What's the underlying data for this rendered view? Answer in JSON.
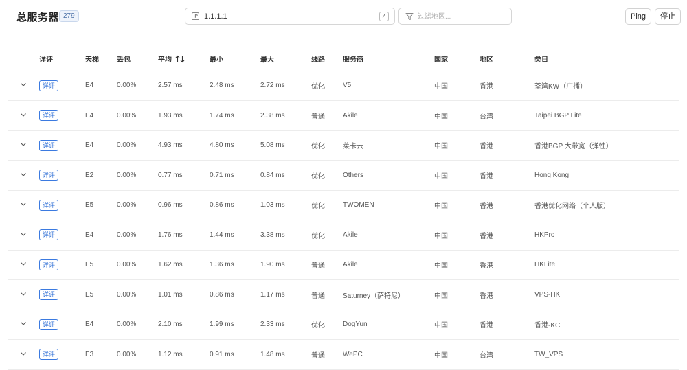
{
  "header": {
    "title": "总服务器",
    "count": "279"
  },
  "search": {
    "value": "1.1.1.1",
    "shortcut": "/",
    "ip_icon": "ip-icon"
  },
  "filter": {
    "placeholder": "过滤地区...",
    "icon": "funnel-icon"
  },
  "buttons": {
    "ping": "Ping",
    "stop": "停止"
  },
  "table": {
    "columns": {
      "detail": "详评",
      "tier": "天梯",
      "loss": "丢包",
      "avg": "平均",
      "min": "最小",
      "max": "最大",
      "route": "线路",
      "provider": "服务商",
      "country": "国家",
      "region": "地区",
      "category": "类目"
    },
    "sort_icon": "sort-arrows-icon",
    "expand_icon": "chevron-down-icon",
    "detail_label": "详评",
    "rows": [
      {
        "tier": "E4",
        "loss": "0.00%",
        "avg": "2.57 ms",
        "min": "2.48 ms",
        "max": "2.72 ms",
        "route": "优化",
        "provider": "V5",
        "country": "中国",
        "region": "香港",
        "category": "荃湾KW（广播）"
      },
      {
        "tier": "E4",
        "loss": "0.00%",
        "avg": "1.93 ms",
        "min": "1.74 ms",
        "max": "2.38 ms",
        "route": "普通",
        "provider": "Akile",
        "country": "中国",
        "region": "台湾",
        "category": "Taipei BGP Lite"
      },
      {
        "tier": "E4",
        "loss": "0.00%",
        "avg": "4.93 ms",
        "min": "4.80 ms",
        "max": "5.08 ms",
        "route": "优化",
        "provider": "莱卡云",
        "country": "中国",
        "region": "香港",
        "category": "香港BGP 大带宽（弹性）"
      },
      {
        "tier": "E2",
        "loss": "0.00%",
        "avg": "0.77 ms",
        "min": "0.71 ms",
        "max": "0.84 ms",
        "route": "优化",
        "provider": "Others",
        "country": "中国",
        "region": "香港",
        "category": "Hong Kong"
      },
      {
        "tier": "E5",
        "loss": "0.00%",
        "avg": "0.96 ms",
        "min": "0.86 ms",
        "max": "1.03 ms",
        "route": "优化",
        "provider": "TWOMEN",
        "country": "中国",
        "region": "香港",
        "category": "香港优化网络（个人版）"
      },
      {
        "tier": "E4",
        "loss": "0.00%",
        "avg": "1.76 ms",
        "min": "1.44 ms",
        "max": "3.38 ms",
        "route": "优化",
        "provider": "Akile",
        "country": "中国",
        "region": "香港",
        "category": "HKPro"
      },
      {
        "tier": "E5",
        "loss": "0.00%",
        "avg": "1.62 ms",
        "min": "1.36 ms",
        "max": "1.90 ms",
        "route": "普通",
        "provider": "Akile",
        "country": "中国",
        "region": "香港",
        "category": "HKLite"
      },
      {
        "tier": "E5",
        "loss": "0.00%",
        "avg": "1.01 ms",
        "min": "0.86 ms",
        "max": "1.17 ms",
        "route": "普通",
        "provider": "Saturney（萨特尼）",
        "country": "中国",
        "region": "香港",
        "category": "VPS-HK"
      },
      {
        "tier": "E4",
        "loss": "0.00%",
        "avg": "2.10 ms",
        "min": "1.99 ms",
        "max": "2.33 ms",
        "route": "优化",
        "provider": "DogYun",
        "country": "中国",
        "region": "香港",
        "category": "香港-KC"
      },
      {
        "tier": "E3",
        "loss": "0.00%",
        "avg": "1.12 ms",
        "min": "0.91 ms",
        "max": "1.48 ms",
        "route": "普通",
        "provider": "WePC",
        "country": "中国",
        "region": "台湾",
        "category": "TW_VPS"
      }
    ]
  },
  "colors": {
    "accent": "#2f6fd6",
    "border": "#e2e2e2",
    "text": "#333333"
  }
}
